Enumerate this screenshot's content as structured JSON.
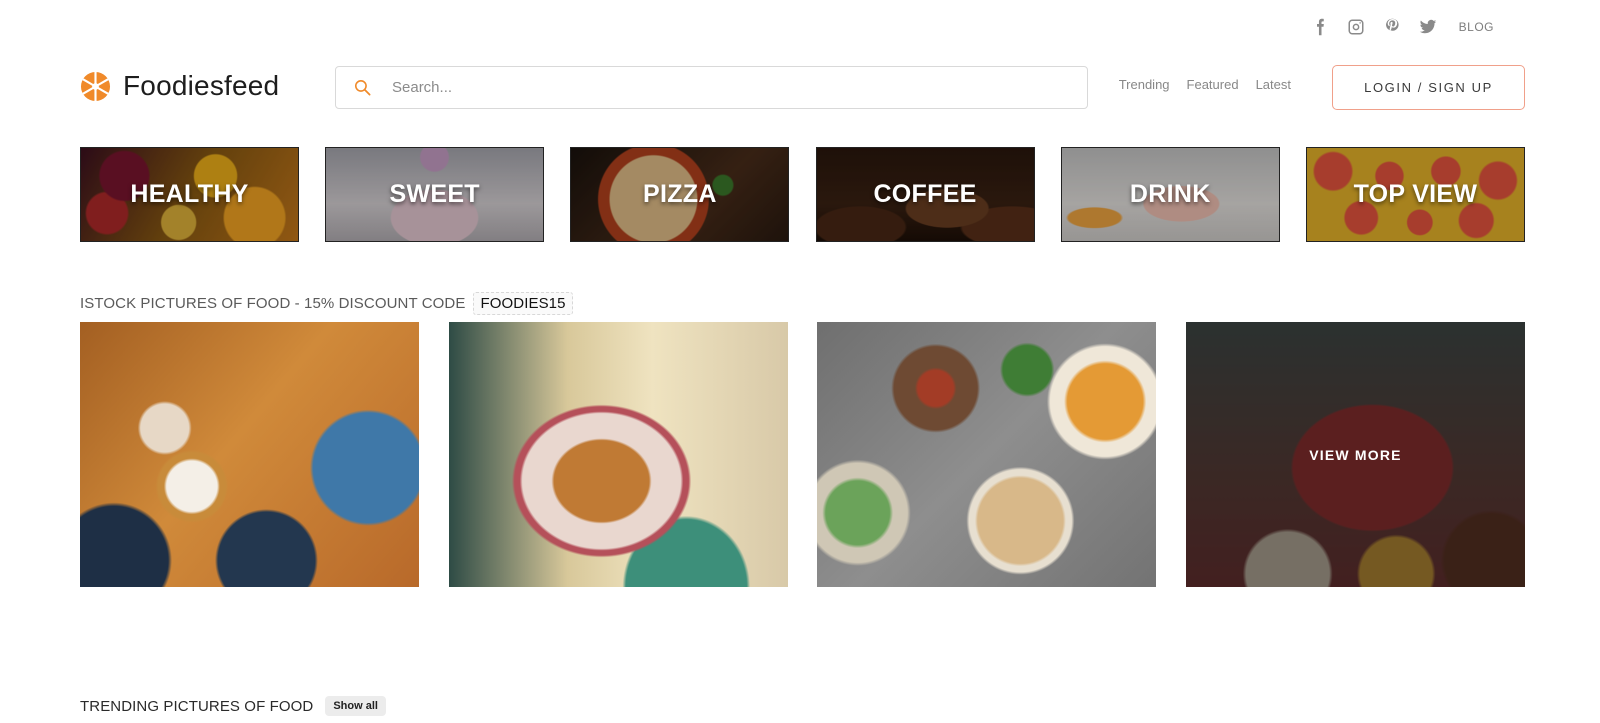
{
  "social": {
    "icons": [
      "facebook-icon",
      "instagram-icon",
      "pinterest-icon",
      "twitter-icon"
    ],
    "blog_label": "BLOG"
  },
  "header": {
    "brand": "Foodiesfeed",
    "search_placeholder": "Search...",
    "nav": {
      "trending": "Trending",
      "featured": "Featured",
      "latest": "Latest"
    },
    "login_label": "LOGIN / SIGN UP"
  },
  "categories": [
    {
      "label": "HEALTHY"
    },
    {
      "label": "SWEET"
    },
    {
      "label": "PIZZA"
    },
    {
      "label": "COFFEE"
    },
    {
      "label": "DRINK"
    },
    {
      "label": "TOP VIEW"
    }
  ],
  "istock": {
    "title": "ISTOCK PICTURES OF FOOD - 15% DISCOUNT CODE",
    "code": "FOODIES15",
    "view_more": "VIEW MORE"
  },
  "trending": {
    "title": "TRENDING PICTURES OF FOOD",
    "show_all": "Show all"
  },
  "colors": {
    "accent": "#f0a08a",
    "logo_orange": "#f08a2a"
  }
}
